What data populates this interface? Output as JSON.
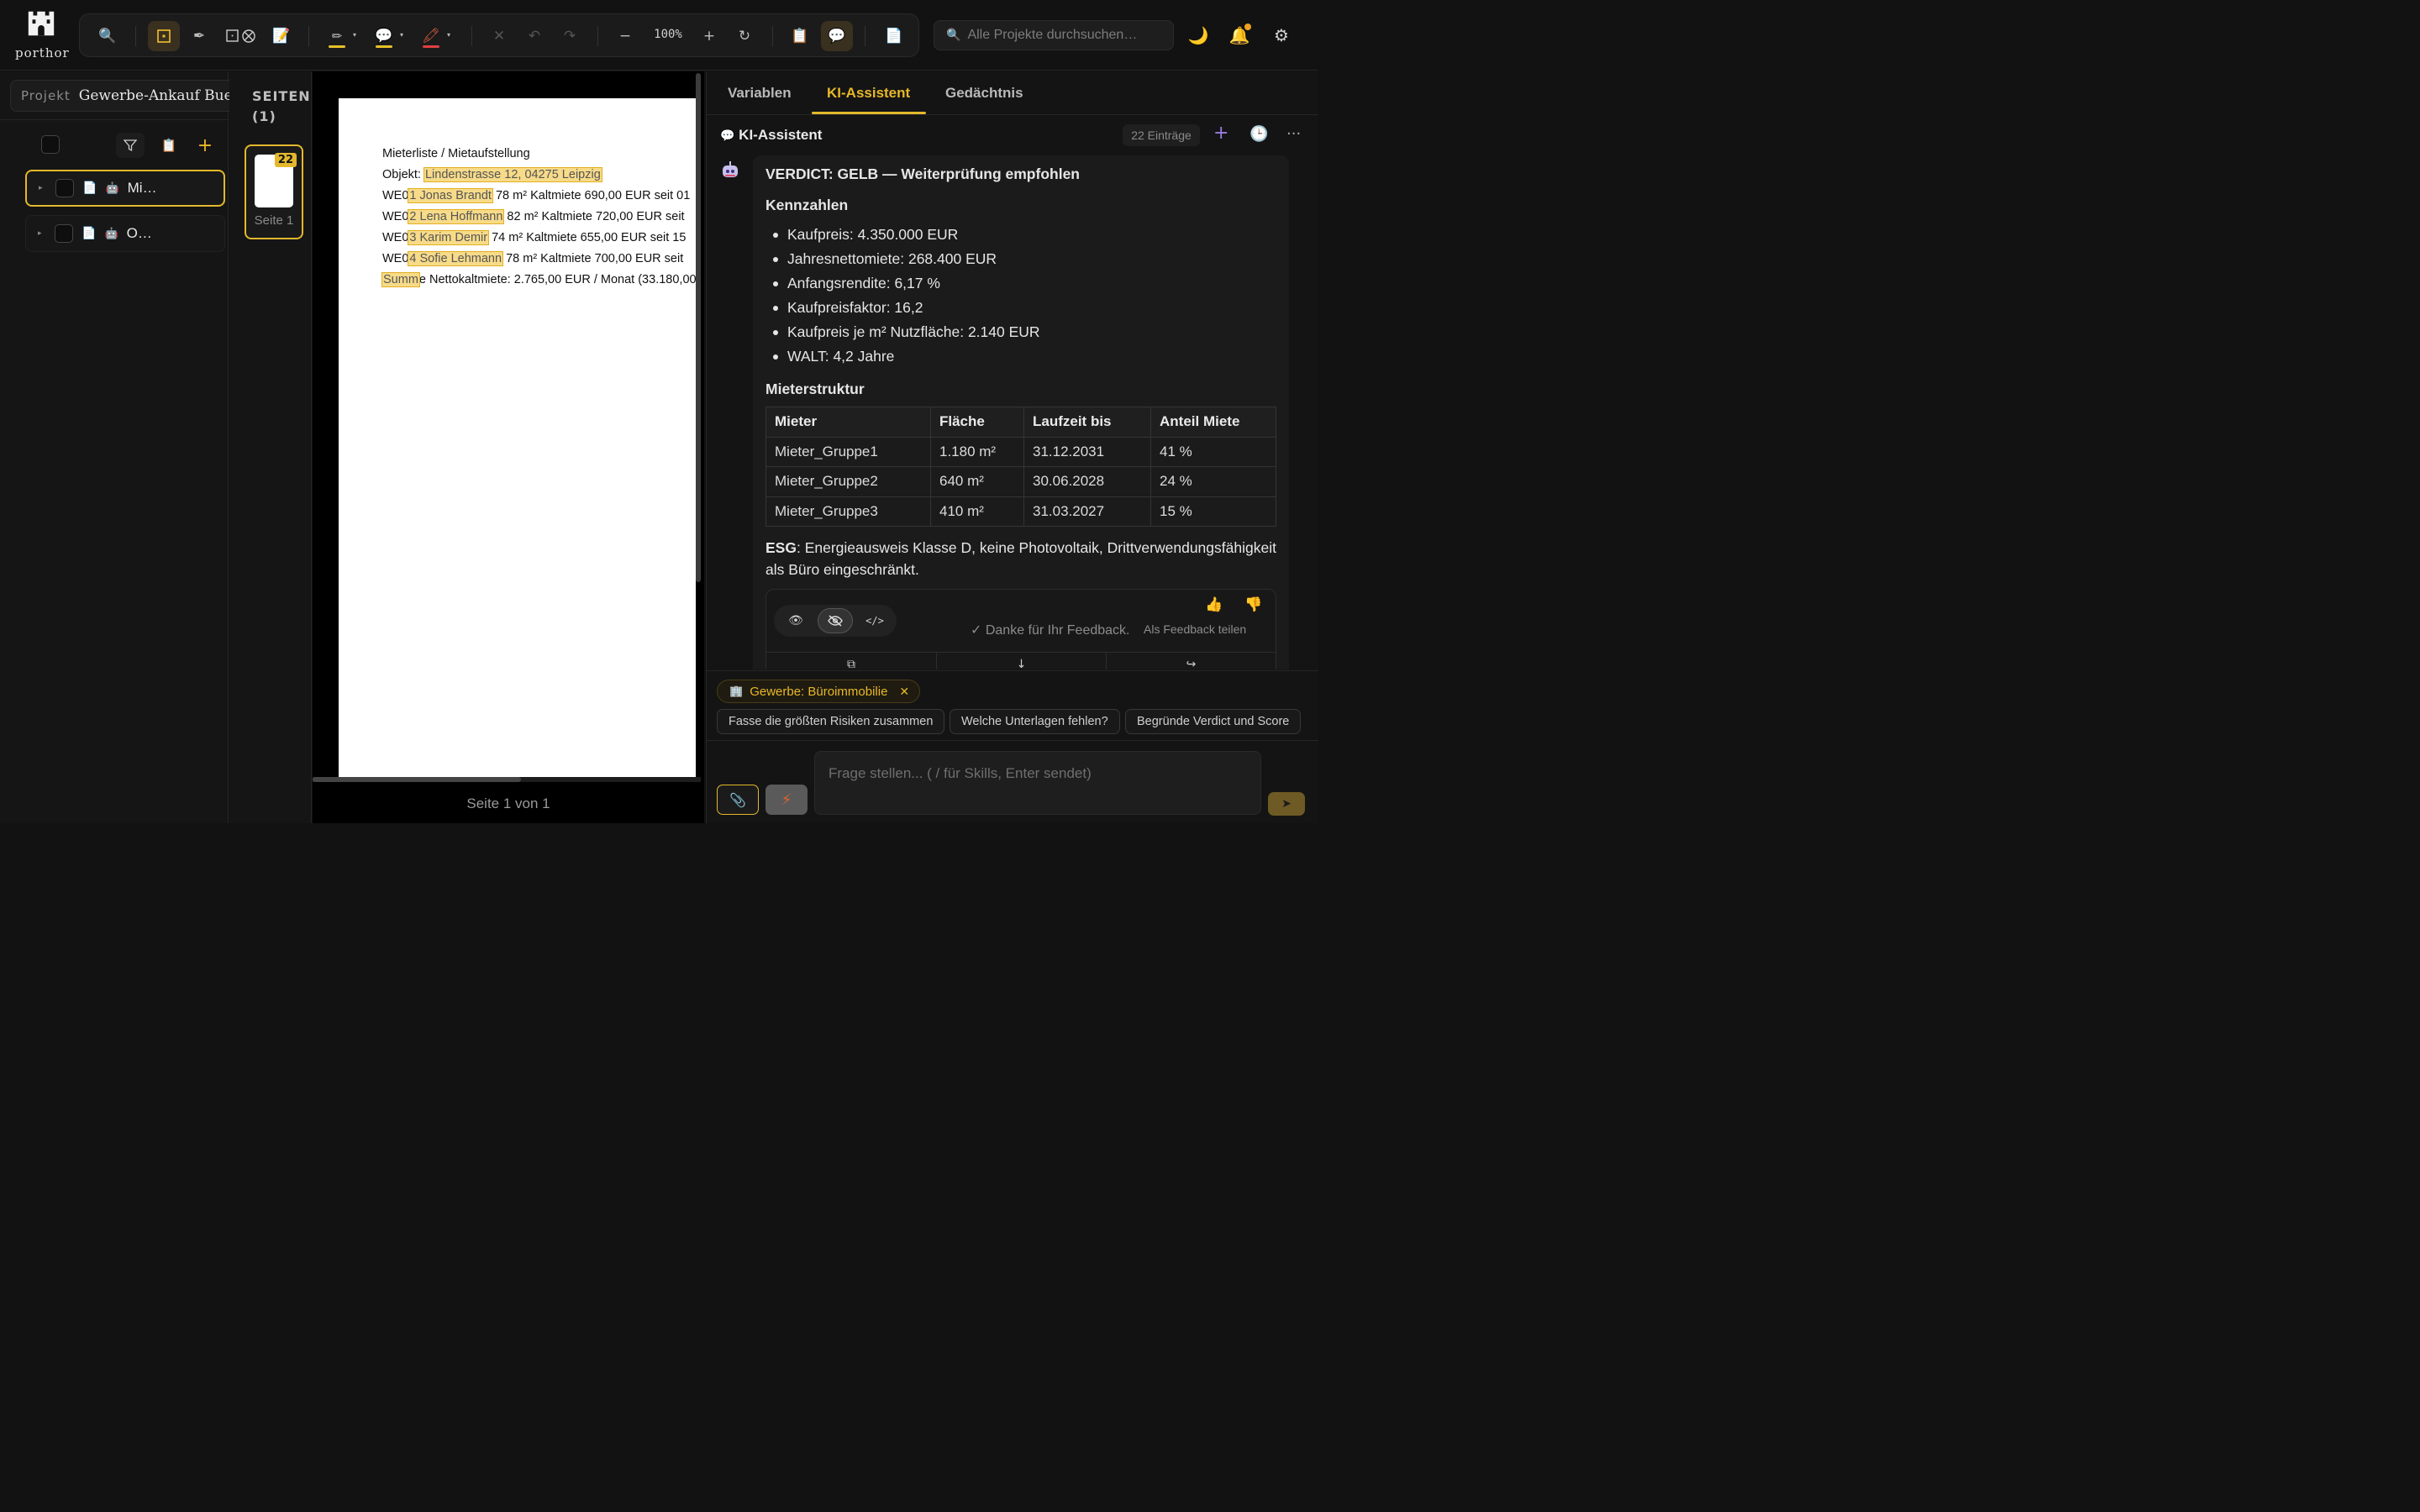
{
  "app": {
    "logo_text": "porthor"
  },
  "toolbar": {
    "zoom": "100%"
  },
  "colors": {
    "accent": "#e3b82c",
    "highlight_yellow": "#e8c02a",
    "highlight_red": "#e04040",
    "notification_dot": "#f0a020"
  },
  "search": {
    "placeholder": "Alle Projekte durchsuchen…"
  },
  "project": {
    "label": "Projekt",
    "name": "Gewerbe-Ankauf Buerohaus"
  },
  "tree": {
    "items": [
      {
        "label": "Mi…",
        "selected": true
      },
      {
        "label": "O…",
        "selected": false
      }
    ]
  },
  "pages": {
    "title_line1": "SEITEN",
    "title_line2": "(1)",
    "thumb_badge": "22",
    "thumb_caption": "Seite 1"
  },
  "document": {
    "title": "Mieterliste / Mietaufstellung",
    "object_label": "Objekt: ",
    "object_value": "Lindenstrasse 12, 04275 Leipzig",
    "units": [
      {
        "prefix": "WE0",
        "name": "1  Jonas Brandt",
        "rest": "  78 m²  Kaltmiete 690,00 EUR  seit 01"
      },
      {
        "prefix": "WE0",
        "name": "2  Lena Hoffmann",
        "rest": "  82 m²  Kaltmiete 720,00 EUR  seit"
      },
      {
        "prefix": "WE0",
        "name": "3  Karim Demir",
        "rest": "  74 m²  Kaltmiete 655,00 EUR  seit 15"
      },
      {
        "prefix": "WE0",
        "name": "4  Sofie Lehmann",
        "rest": "  78 m²  Kaltmiete 700,00 EUR  seit"
      }
    ],
    "sum_highlight": "Summ",
    "sum_rest": "e Nettokaltmiete: 2.765,00 EUR / Monat  (33.180,00"
  },
  "viewer": {
    "page_indicator": "Seite 1 von 1"
  },
  "right": {
    "tabs": [
      {
        "label": "Variablen",
        "active": false
      },
      {
        "label": "KI-Assistent",
        "active": true
      },
      {
        "label": "Gedächtnis",
        "active": false
      }
    ],
    "assistant_title": "KI-Assistent",
    "entries": "22 Einträge"
  },
  "message": {
    "verdict": "VERDICT: GELB — Weiterprüfung empfohlen",
    "kennzahlen_title": "Kennzahlen",
    "kennzahlen": [
      "Kaufpreis: 4.350.000 EUR",
      "Jahresnettomiete: 268.400 EUR",
      "Anfangsrendite: 6,17 %",
      "Kaufpreisfaktor: 16,2",
      "Kaufpreis je m² Nutzfläche: 2.140 EUR",
      "WALT: 4,2 Jahre"
    ],
    "mieter_title": "Mieterstruktur",
    "table": {
      "headers": [
        "Mieter",
        "Fläche",
        "Laufzeit bis",
        "Anteil Miete"
      ],
      "rows": [
        [
          "Mieter_Gruppe1",
          "1.180 m²",
          "31.12.2031",
          "41 %"
        ],
        [
          "Mieter_Gruppe2",
          "640 m²",
          "30.06.2028",
          "24 %"
        ],
        [
          "Mieter_Gruppe3",
          "410 m²",
          "31.03.2027",
          "15 %"
        ]
      ]
    },
    "esg_label": "ESG",
    "esg_text": ": Energieausweis Klasse D, keine Photovoltaik, Drittverwendungsfähigkeit als Büro eingeschränkt.",
    "feedback_thanks": "✓ Danke für Ihr Feedback.",
    "share_feedback": "Als Feedback teilen"
  },
  "context": {
    "chip": "Gewerbe: Büroimmobilie"
  },
  "suggestions": [
    "Fasse die größten Risiken zusammen",
    "Welche Unterlagen fehlen?",
    "Begründe Verdict und Score"
  ],
  "input": {
    "placeholder": "Frage stellen... ( / für Skills, Enter sendet)"
  }
}
